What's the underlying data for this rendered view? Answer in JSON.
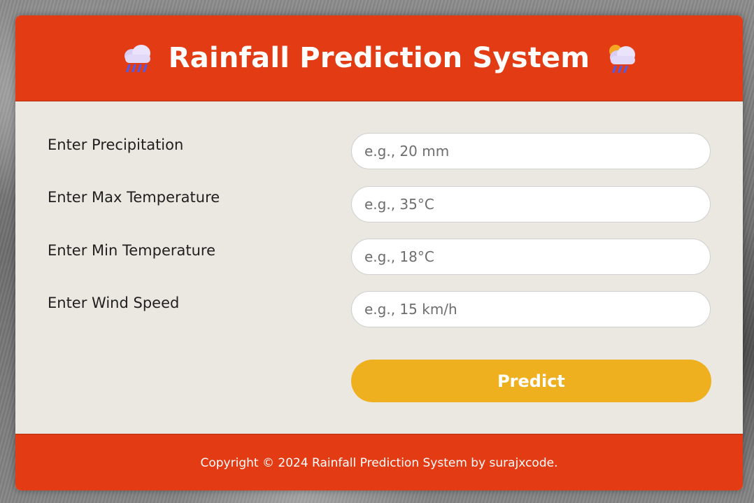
{
  "header": {
    "title": "Rainfall Prediction System",
    "left_icon": "cloud-rain-icon",
    "right_icon": "sun-behind-rain-cloud-icon"
  },
  "form": {
    "fields": [
      {
        "label": "Enter Precipitation",
        "placeholder": "e.g., 20 mm"
      },
      {
        "label": "Enter Max Temperature",
        "placeholder": "e.g., 35°C"
      },
      {
        "label": "Enter Min Temperature",
        "placeholder": "e.g., 18°C"
      },
      {
        "label": "Enter Wind Speed",
        "placeholder": "e.g., 15 km/h"
      }
    ],
    "submit_label": "Predict"
  },
  "footer": {
    "text": "Copyright © 2024 Rainfall Prediction System by surajxcode."
  },
  "colors": {
    "header_bg": "#e33b13",
    "footer_bg": "#e33b13",
    "form_bg": "#ebe8e1",
    "button_bg": "#efb020"
  }
}
